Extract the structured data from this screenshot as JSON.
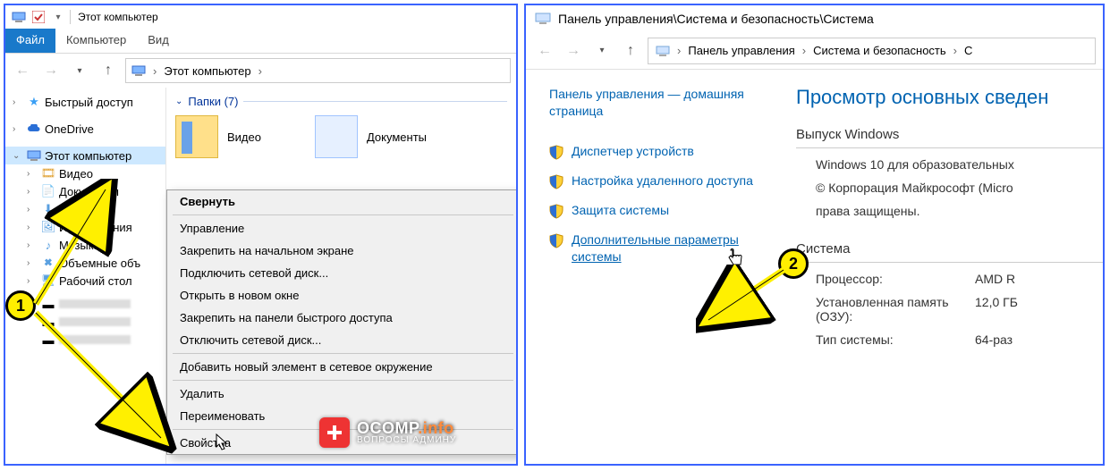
{
  "left": {
    "qat_title": "Этот компьютер",
    "tabs": {
      "file": "Файл",
      "computer": "Компьютер",
      "view": "Вид"
    },
    "breadcrumb": {
      "root": "Этот компьютер"
    },
    "tree": {
      "quick": "Быстрый доступ",
      "onedrive": "OneDrive",
      "thispc": "Этот компьютер",
      "videos": "Видео",
      "documents": "Документы",
      "downloads": "Загрузки",
      "pictures": "Изображения",
      "music": "Музыка",
      "volumes": "Объемные объ",
      "desktop": "Рабочий стол"
    },
    "group_header": "Папки (7)",
    "tiles": {
      "videos": "Видео",
      "documents": "Документы"
    },
    "ctx": {
      "collapse": "Свернуть",
      "manage": "Управление",
      "pin_start": "Закрепить на начальном экране",
      "map_drive": "Подключить сетевой диск...",
      "open_new": "Открыть в новом окне",
      "pin_quick": "Закрепить на панели быстрого доступа",
      "disconnect": "Отключить сетевой диск...",
      "add_network": "Добавить новый элемент в сетевое окружение",
      "delete": "Удалить",
      "rename": "Переименовать",
      "properties": "Свойства"
    }
  },
  "right": {
    "title_path": "Панель управления\\Система и безопасность\\Система",
    "crumbs": {
      "a": "Панель управления",
      "b": "Система и безопасность",
      "c": "С"
    },
    "home": "Панель управления — домашняя страница",
    "links": {
      "devmgr": "Диспетчер устройств",
      "remote": "Настройка удаленного доступа",
      "protect": "Защита системы",
      "advanced": "Дополнительные параметры системы"
    },
    "heading": "Просмотр основных сведен",
    "edition_h": "Выпуск Windows",
    "edition_v": "Windows 10 для образовательных",
    "copyright": "© Корпорация Майкрософт (Micro",
    "rights": "права защищены.",
    "system_h": "Система",
    "cpu_k": "Процессор:",
    "cpu_v": "AMD R",
    "ram_k": "Установленная память (ОЗУ):",
    "ram_v": "12,0 ГБ",
    "type_k": "Тип системы:",
    "type_v": "64-раз"
  },
  "markers": {
    "one": "1",
    "two": "2"
  },
  "watermark": {
    "brand": "OCOMP",
    "tld": ".info",
    "sub": "ВОПРОСЫ АДМИНУ"
  }
}
